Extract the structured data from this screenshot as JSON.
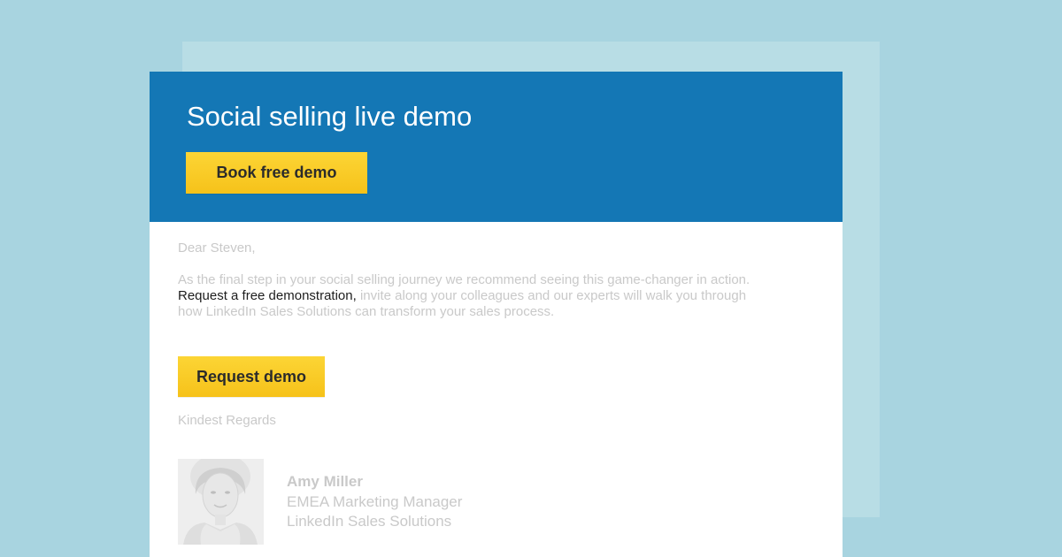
{
  "email": {
    "header": {
      "title": "Social selling live demo",
      "button_label": "Book free demo"
    },
    "greeting": "Dear Steven,",
    "body": {
      "before_link": "As the final step in your social selling journey we recommend seeing this game-changer in action. ",
      "link_text": "Request a free demonstration,",
      "after_link": " invite along your colleagues and our experts will walk you through how LinkedIn Sales Solutions can transform your sales process."
    },
    "cta_button_label": "Request demo",
    "closing": "Kindest Regards",
    "signature": {
      "name": "Amy Miller",
      "role": "EMEA Marketing Manager",
      "company": "LinkedIn Sales Solutions"
    }
  },
  "colors": {
    "page_background": "#a8d4e0",
    "back_card": "#b8dde5",
    "header_blue": "#1477b5",
    "button_yellow": "#f9cb27",
    "muted_text": "#c9c9c9",
    "link_text": "#1d1d1d"
  },
  "icons": {
    "avatar": "person-photo"
  }
}
